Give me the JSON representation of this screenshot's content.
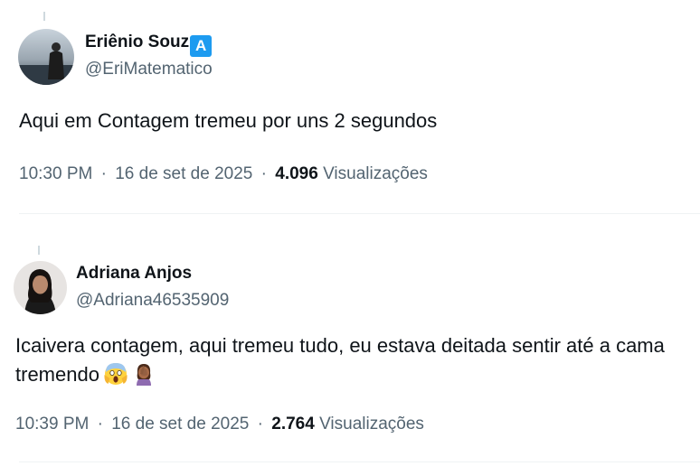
{
  "tweets": [
    {
      "author_name": "Eriênio Souz",
      "badge_letter": "A",
      "handle": "@EriMatematico",
      "text": "Aqui em Contagem tremeu por uns 2 segundos",
      "time": "10:30 PM",
      "date": "16 de set de 2025",
      "views_count": "4.096",
      "views_label": "Visualizações",
      "separator": "·"
    },
    {
      "author_name": "Adriana Anjos",
      "handle": "@Adriana46535909",
      "text": "Icaivera contagem, aqui tremeu tudo, eu estava deitada sentir até a cama tremendo",
      "emojis": [
        "face-screaming-in-fear-emoji",
        "woman-facepalming-emoji"
      ],
      "time": "10:39 PM",
      "date": "16 de set de 2025",
      "views_count": "2.764",
      "views_label": "Visualizações",
      "separator": "·"
    }
  ],
  "colors": {
    "text_primary": "#0f1419",
    "text_secondary": "#536471",
    "badge": "#1d9bf0",
    "divider": "#eff3f4"
  }
}
